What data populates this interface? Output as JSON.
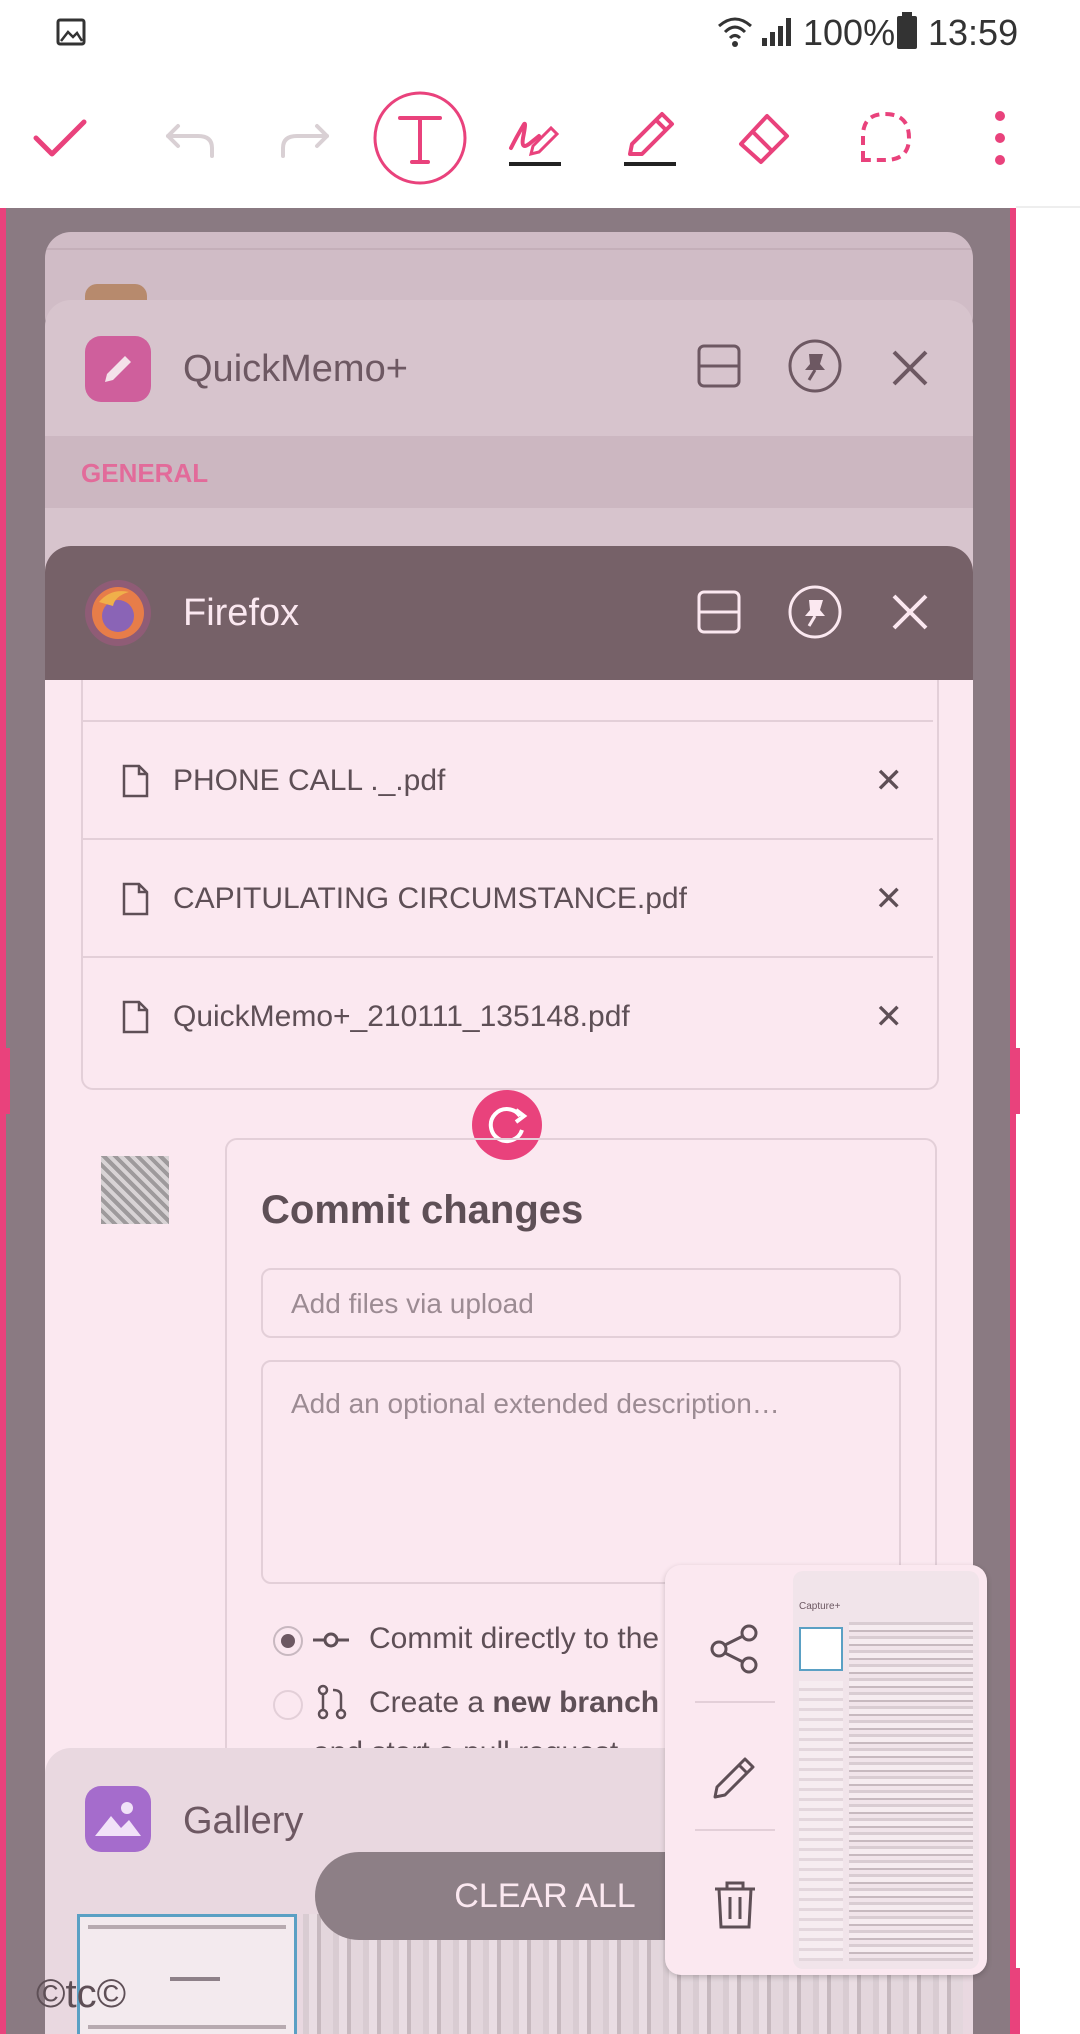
{
  "status_bar": {
    "battery_percent": "100%",
    "time": "13:59",
    "icons": [
      "image-icon",
      "wifi-icon",
      "signal-icon",
      "battery-icon"
    ]
  },
  "toolbar": {
    "icons": [
      "check-icon",
      "undo-icon",
      "redo-icon",
      "text-icon",
      "handwriting-pen-icon",
      "pencil-icon",
      "eraser-icon",
      "lasso-icon",
      "more-icon"
    ]
  },
  "quickmemo_card": {
    "app_name": "QuickMemo+",
    "section_label": "GENERAL"
  },
  "firefox_card": {
    "app_name": "Firefox",
    "files": [
      {
        "name": "PHONE CALL ._.pdf"
      },
      {
        "name": "CAPITULATING CIRCUMSTANCE.pdf"
      },
      {
        "name": "QuickMemo+_210111_135148.pdf"
      }
    ],
    "commit": {
      "title": "Commit changes",
      "summary_placeholder": "Add files via upload",
      "description_placeholder": "Add an optional extended description…",
      "option_direct": "Commit directly to the",
      "option_branch_prefix": "Create a",
      "option_branch_bold": "new branch",
      "option_branch_line2": "and start a pull request."
    }
  },
  "gallery_card": {
    "app_name": "Gallery",
    "clear_all": "CLEAR ALL"
  },
  "screenshot_preview": {
    "title": "Capture+"
  },
  "watermark": "©tc©",
  "colors": {
    "accent": "#e9427c",
    "overlay": "#8a7a82",
    "card_bg": "#fbe8f0"
  }
}
